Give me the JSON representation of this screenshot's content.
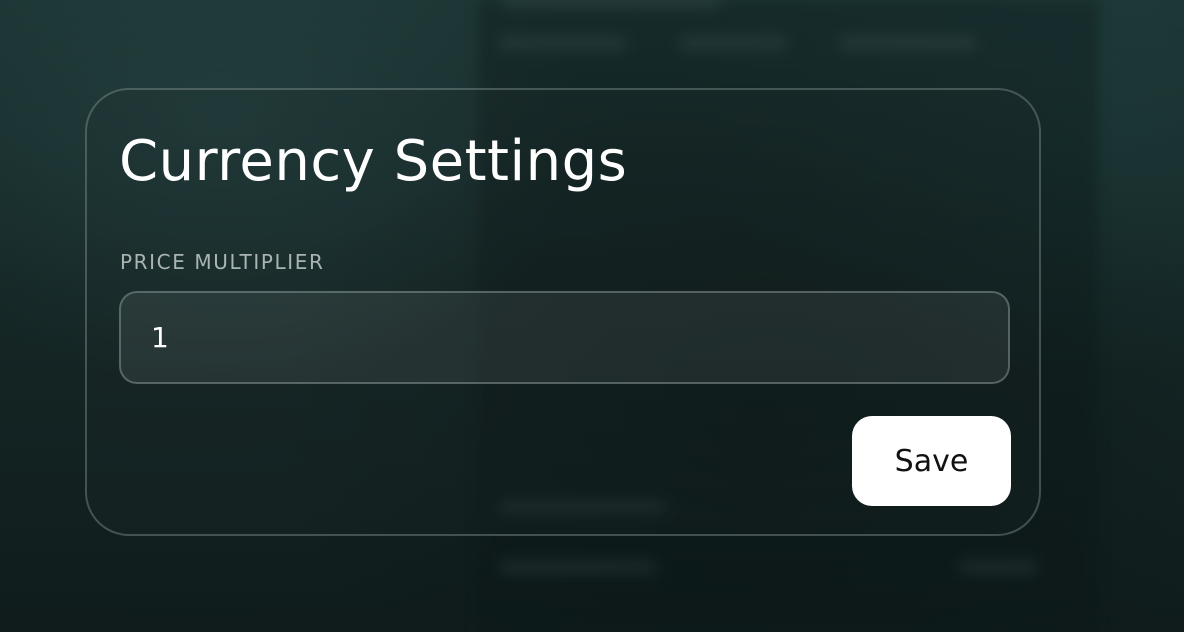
{
  "dialog": {
    "title": "Currency Settings",
    "field_label": "PRICE MULTIPLIER",
    "field_value": "1",
    "save_label": "Save"
  },
  "colors": {
    "background": "#152423",
    "text": "#ffffff",
    "label": "#a9b4b3",
    "button_bg": "#ffffff",
    "button_text": "#111111"
  }
}
